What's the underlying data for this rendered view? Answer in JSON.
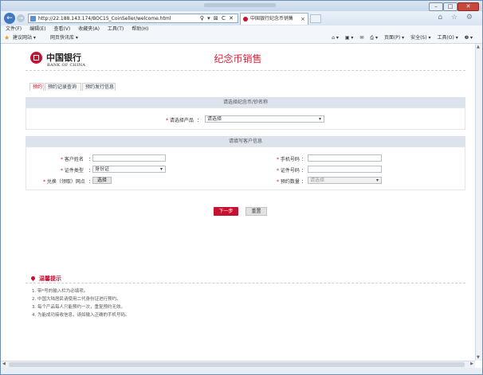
{
  "browser": {
    "nav": {
      "back": "←",
      "forward": "→"
    },
    "address": "http://22.188.143.174/BOC15_CoinSeller/welcome.html",
    "address_tools": "♀ ▾ ⊠ C ✕",
    "tab_title": "中国银行纪念币销售",
    "tab_close": "×",
    "right_icons": "⌂ ☆ ⚙",
    "window_buttons": {
      "minimize": "–",
      "maximize": "□",
      "close": "✕"
    },
    "menu": [
      "文件(F)",
      "编辑(E)",
      "查看(V)",
      "收藏夹(A)",
      "工具(T)",
      "帮助(H)"
    ],
    "favorites": {
      "star": "★",
      "items": [
        "建议网站 ▾",
        "网页快讯库 ▾"
      ],
      "right": [
        "⌂ ▾",
        "▣ ▾",
        "✉",
        "⎙ ▾",
        "页面(P) ▾",
        "安全(S) ▾",
        "工具(O) ▾",
        "❷ ▾"
      ]
    }
  },
  "page": {
    "logo_cn": "中国银行",
    "logo_en": "BANK OF CHINA",
    "title": "纪念币销售",
    "tabs": [
      "预约",
      "预约记录查询",
      "预约发行信息"
    ],
    "section1": {
      "heading": "请选择纪念币/钞名称",
      "product_label": "请选择产品",
      "product_value": "请选择",
      "colon": "："
    },
    "section2": {
      "heading": "请填写客户信息",
      "customer_name_label": "客户姓名",
      "id_type_label": "证件类型",
      "id_type_value": "身份证",
      "exchange_branch_label": "兑换（领取）网点",
      "select_button": "选择",
      "phone_label": "手机号码",
      "id_number_label": "证件号码",
      "quantity_label": "预约数量",
      "quantity_placeholder": "请选择",
      "colon": "："
    },
    "next_button": "下一步",
    "reset_button": "重置",
    "tips": {
      "title": "温馨提示",
      "items": [
        "1. 带*号的输入栏为必填项。",
        "2. 中国大陆居民请使用二代身份证进行预约。",
        "3. 每个产品每人只能预约一次，重复预约无效。",
        "4. 为能成功接收信息，请如输入正确的手机号码。"
      ]
    }
  }
}
